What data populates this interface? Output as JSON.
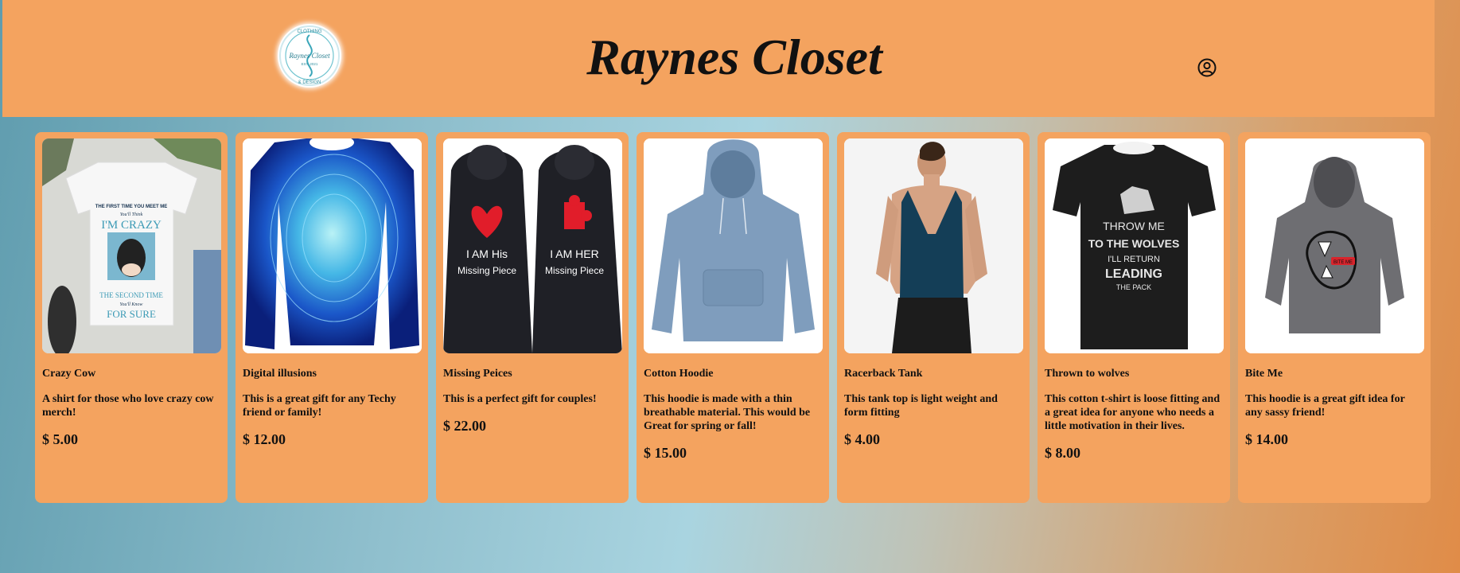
{
  "site": {
    "title": "Raynes Closet",
    "logo_text": "Raynes Closet",
    "logo_ring_top": "CLOTHING",
    "logo_ring_bottom": "& DESIGN",
    "logo_sub": "EST. 2021"
  },
  "header": {
    "account_icon": "user-circle-icon"
  },
  "products": [
    {
      "name": "Crazy Cow",
      "description": "A shirt for those who love crazy cow merch!",
      "price": "$ 5.00",
      "shirt_text": [
        "THE FIRST TIME YOU MEET ME",
        "You'll Think",
        "I'M CRAZY",
        "THE SECOND TIME",
        "You'll Know",
        "FOR SURE"
      ]
    },
    {
      "name": "Digital illusions",
      "description": "This is a great gift for any Techy friend or family!",
      "price": "$ 12.00"
    },
    {
      "name": "Missing Peices",
      "description": "This is a perfect gift for couples!",
      "price": "$ 22.00",
      "shirt_text": [
        "I AM His",
        "Missing Piece",
        "I AM HER",
        "Missing Piece"
      ]
    },
    {
      "name": "Cotton Hoodie",
      "description": "This hoodie is made with a thin breathable material. This would be Great for spring or fall!",
      "price": "$ 15.00"
    },
    {
      "name": "Racerback Tank",
      "description": "This tank top is light weight and form fitting",
      "price": "$ 4.00"
    },
    {
      "name": "Thrown to wolves",
      "description": "This cotton t-shirt is loose fitting and a great idea for anyone who needs a little motivation in their lives.",
      "price": "$ 8.00",
      "shirt_text": [
        "THROW ME",
        "TO THE WOLVES",
        "I'LL RETURN",
        "LEADING",
        "THE PACK"
      ]
    },
    {
      "name": "Bite Me",
      "description": "This hoodie is a great gift idea for any sassy friend!",
      "price": "$ 14.00",
      "shirt_text": [
        "BITE ME"
      ]
    }
  ]
}
